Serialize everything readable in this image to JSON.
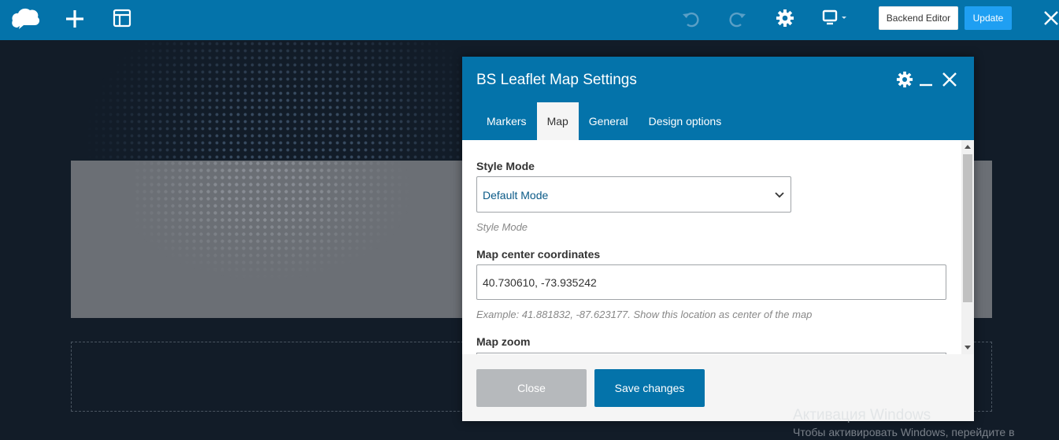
{
  "toolbar": {
    "icons": {
      "logo": "cloud-logo-icon",
      "add": "plus-icon",
      "layout": "layout-icon",
      "undo": "undo-icon",
      "redo": "redo-icon",
      "settings": "gear-icon",
      "device": "monitor-icon",
      "close": "close-icon"
    },
    "backend_editor_label": "Backend Editor",
    "update_label": "Update"
  },
  "modal": {
    "title": "BS Leaflet Map Settings",
    "header_icons": [
      "gear-icon",
      "minimize-icon",
      "close-icon"
    ],
    "tabs": [
      {
        "label": "Markers",
        "active": false
      },
      {
        "label": "Map",
        "active": true
      },
      {
        "label": "General",
        "active": false
      },
      {
        "label": "Design options",
        "active": false
      }
    ],
    "fields": {
      "style_mode": {
        "label": "Style Mode",
        "value": "Default Mode",
        "help": "Style Mode"
      },
      "center": {
        "label": "Map center coordinates",
        "value": "40.730610, -73.935242",
        "help": "Example: 41.881832, -87.623177. Show this location as center of the map"
      },
      "zoom": {
        "label": "Map zoom"
      }
    },
    "footer": {
      "close_label": "Close",
      "save_label": "Save changes"
    }
  },
  "watermark": {
    "title": "Активация Windows",
    "subtitle": "Чтобы активировать Windows, перейдите в"
  },
  "colors": {
    "toolbar": "#0473aa",
    "update_button": "#1f9ff2",
    "save_button": "#0473aa",
    "close_button": "#b6b9bc",
    "canvas": "#121c28"
  }
}
